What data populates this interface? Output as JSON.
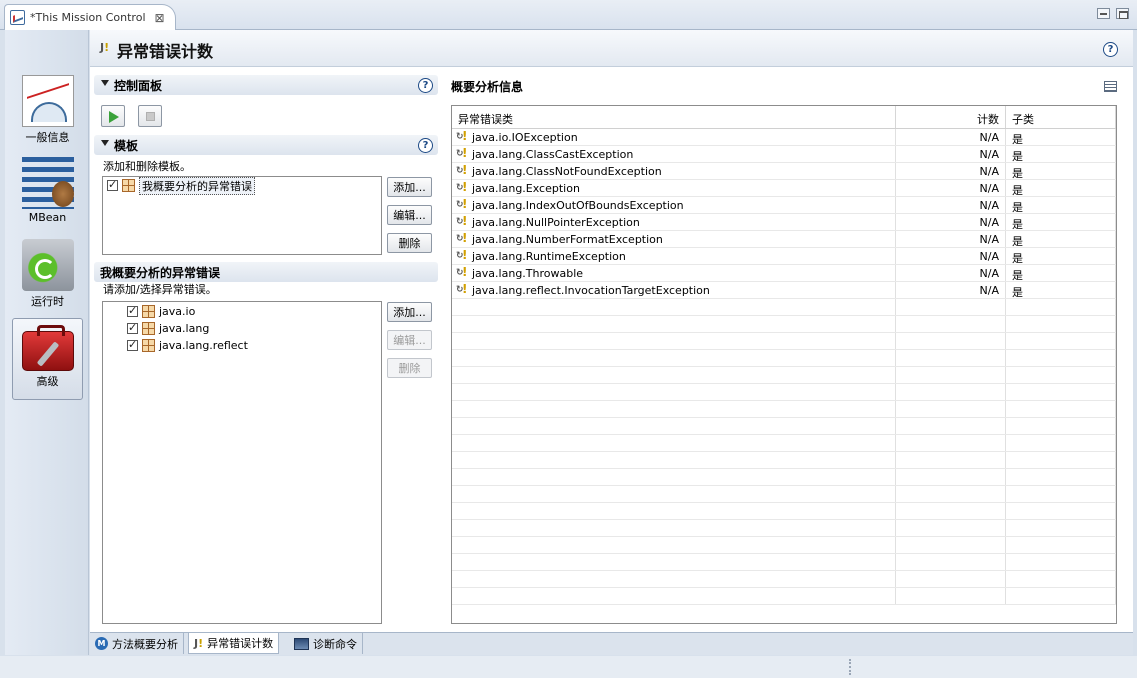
{
  "editor_tab": {
    "title": "*This Mission Control"
  },
  "nav": [
    {
      "label": "一般信息"
    },
    {
      "label": "MBean"
    },
    {
      "label": "运行时"
    },
    {
      "label": "高级"
    }
  ],
  "page": {
    "icon_text": "J",
    "title": "异常错误计数"
  },
  "control_panel": {
    "title": "控制面板"
  },
  "templates": {
    "title": "模板",
    "description": "添加和删除模板。",
    "items": [
      {
        "label": "我概要分析的异常错误",
        "checked": true
      }
    ],
    "buttons": {
      "add": "添加...",
      "edit": "编辑...",
      "delete": "删除"
    }
  },
  "my_exceptions": {
    "title": "我概要分析的异常错误",
    "description": "请添加/选择异常错误。",
    "items": [
      {
        "label": "java.io",
        "checked": true
      },
      {
        "label": "java.lang",
        "checked": true
      },
      {
        "label": "java.lang.reflect",
        "checked": true
      }
    ],
    "buttons": {
      "add": "添加...",
      "edit": "编辑...",
      "delete": "删除"
    }
  },
  "summary": {
    "title": "概要分析信息",
    "columns": {
      "type": "异常错误类",
      "count": "计数",
      "subclass": "子类"
    },
    "rows": [
      {
        "type": "java.io.IOException",
        "count": "N/A",
        "subclass": "是"
      },
      {
        "type": "java.lang.ClassCastException",
        "count": "N/A",
        "subclass": "是"
      },
      {
        "type": "java.lang.ClassNotFoundException",
        "count": "N/A",
        "subclass": "是"
      },
      {
        "type": "java.lang.Exception",
        "count": "N/A",
        "subclass": "是"
      },
      {
        "type": "java.lang.IndexOutOfBoundsException",
        "count": "N/A",
        "subclass": "是"
      },
      {
        "type": "java.lang.NullPointerException",
        "count": "N/A",
        "subclass": "是"
      },
      {
        "type": "java.lang.NumberFormatException",
        "count": "N/A",
        "subclass": "是"
      },
      {
        "type": "java.lang.RuntimeException",
        "count": "N/A",
        "subclass": "是"
      },
      {
        "type": "java.lang.Throwable",
        "count": "N/A",
        "subclass": "是"
      },
      {
        "type": "java.lang.reflect.InvocationTargetException",
        "count": "N/A",
        "subclass": "是"
      }
    ]
  },
  "bottom_tabs": [
    {
      "label": "方法概要分析",
      "icon": "m-icon",
      "icon_text": "M"
    },
    {
      "label": "异常错误计数",
      "icon": "exception-icon",
      "icon_text": "J"
    },
    {
      "label": "诊断命令",
      "icon": "diagnostic-icon"
    }
  ]
}
